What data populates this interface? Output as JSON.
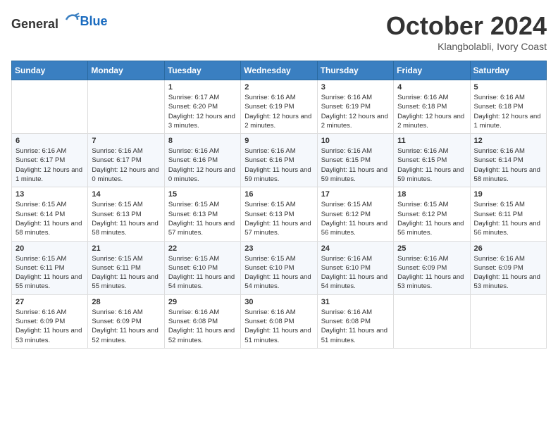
{
  "logo": {
    "general": "General",
    "blue": "Blue"
  },
  "header": {
    "month": "October 2024",
    "location": "Klangbolabli, Ivory Coast"
  },
  "weekdays": [
    "Sunday",
    "Monday",
    "Tuesday",
    "Wednesday",
    "Thursday",
    "Friday",
    "Saturday"
  ],
  "weeks": [
    [
      {
        "day": "",
        "info": ""
      },
      {
        "day": "",
        "info": ""
      },
      {
        "day": "1",
        "info": "Sunrise: 6:17 AM\nSunset: 6:20 PM\nDaylight: 12 hours and 3 minutes."
      },
      {
        "day": "2",
        "info": "Sunrise: 6:16 AM\nSunset: 6:19 PM\nDaylight: 12 hours and 2 minutes."
      },
      {
        "day": "3",
        "info": "Sunrise: 6:16 AM\nSunset: 6:19 PM\nDaylight: 12 hours and 2 minutes."
      },
      {
        "day": "4",
        "info": "Sunrise: 6:16 AM\nSunset: 6:18 PM\nDaylight: 12 hours and 2 minutes."
      },
      {
        "day": "5",
        "info": "Sunrise: 6:16 AM\nSunset: 6:18 PM\nDaylight: 12 hours and 1 minute."
      }
    ],
    [
      {
        "day": "6",
        "info": "Sunrise: 6:16 AM\nSunset: 6:17 PM\nDaylight: 12 hours and 1 minute."
      },
      {
        "day": "7",
        "info": "Sunrise: 6:16 AM\nSunset: 6:17 PM\nDaylight: 12 hours and 0 minutes."
      },
      {
        "day": "8",
        "info": "Sunrise: 6:16 AM\nSunset: 6:16 PM\nDaylight: 12 hours and 0 minutes."
      },
      {
        "day": "9",
        "info": "Sunrise: 6:16 AM\nSunset: 6:16 PM\nDaylight: 11 hours and 59 minutes."
      },
      {
        "day": "10",
        "info": "Sunrise: 6:16 AM\nSunset: 6:15 PM\nDaylight: 11 hours and 59 minutes."
      },
      {
        "day": "11",
        "info": "Sunrise: 6:16 AM\nSunset: 6:15 PM\nDaylight: 11 hours and 59 minutes."
      },
      {
        "day": "12",
        "info": "Sunrise: 6:16 AM\nSunset: 6:14 PM\nDaylight: 11 hours and 58 minutes."
      }
    ],
    [
      {
        "day": "13",
        "info": "Sunrise: 6:15 AM\nSunset: 6:14 PM\nDaylight: 11 hours and 58 minutes."
      },
      {
        "day": "14",
        "info": "Sunrise: 6:15 AM\nSunset: 6:13 PM\nDaylight: 11 hours and 58 minutes."
      },
      {
        "day": "15",
        "info": "Sunrise: 6:15 AM\nSunset: 6:13 PM\nDaylight: 11 hours and 57 minutes."
      },
      {
        "day": "16",
        "info": "Sunrise: 6:15 AM\nSunset: 6:13 PM\nDaylight: 11 hours and 57 minutes."
      },
      {
        "day": "17",
        "info": "Sunrise: 6:15 AM\nSunset: 6:12 PM\nDaylight: 11 hours and 56 minutes."
      },
      {
        "day": "18",
        "info": "Sunrise: 6:15 AM\nSunset: 6:12 PM\nDaylight: 11 hours and 56 minutes."
      },
      {
        "day": "19",
        "info": "Sunrise: 6:15 AM\nSunset: 6:11 PM\nDaylight: 11 hours and 56 minutes."
      }
    ],
    [
      {
        "day": "20",
        "info": "Sunrise: 6:15 AM\nSunset: 6:11 PM\nDaylight: 11 hours and 55 minutes."
      },
      {
        "day": "21",
        "info": "Sunrise: 6:15 AM\nSunset: 6:11 PM\nDaylight: 11 hours and 55 minutes."
      },
      {
        "day": "22",
        "info": "Sunrise: 6:15 AM\nSunset: 6:10 PM\nDaylight: 11 hours and 54 minutes."
      },
      {
        "day": "23",
        "info": "Sunrise: 6:15 AM\nSunset: 6:10 PM\nDaylight: 11 hours and 54 minutes."
      },
      {
        "day": "24",
        "info": "Sunrise: 6:16 AM\nSunset: 6:10 PM\nDaylight: 11 hours and 54 minutes."
      },
      {
        "day": "25",
        "info": "Sunrise: 6:16 AM\nSunset: 6:09 PM\nDaylight: 11 hours and 53 minutes."
      },
      {
        "day": "26",
        "info": "Sunrise: 6:16 AM\nSunset: 6:09 PM\nDaylight: 11 hours and 53 minutes."
      }
    ],
    [
      {
        "day": "27",
        "info": "Sunrise: 6:16 AM\nSunset: 6:09 PM\nDaylight: 11 hours and 53 minutes."
      },
      {
        "day": "28",
        "info": "Sunrise: 6:16 AM\nSunset: 6:09 PM\nDaylight: 11 hours and 52 minutes."
      },
      {
        "day": "29",
        "info": "Sunrise: 6:16 AM\nSunset: 6:08 PM\nDaylight: 11 hours and 52 minutes."
      },
      {
        "day": "30",
        "info": "Sunrise: 6:16 AM\nSunset: 6:08 PM\nDaylight: 11 hours and 51 minutes."
      },
      {
        "day": "31",
        "info": "Sunrise: 6:16 AM\nSunset: 6:08 PM\nDaylight: 11 hours and 51 minutes."
      },
      {
        "day": "",
        "info": ""
      },
      {
        "day": "",
        "info": ""
      }
    ]
  ]
}
